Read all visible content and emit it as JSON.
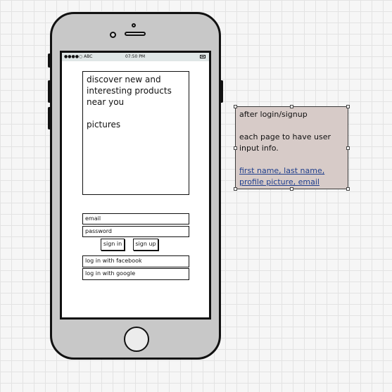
{
  "status_bar": {
    "carrier": "●●●●○ ABC",
    "time": "07:50 PM",
    "battery_icon": "battery-icon"
  },
  "hero": {
    "line1": "discover new and",
    "line2": "interesting products",
    "line3": "near you",
    "line4": "pictures"
  },
  "login": {
    "email_placeholder": "email",
    "password_placeholder": "password",
    "sign_in_label": "sign in",
    "sign_up_label": "sign up",
    "facebook_label": "log in with facebook",
    "google_label": "log in with google"
  },
  "note": {
    "line1": "after login/signup",
    "line2": "each page to have user",
    "line3": "input info.",
    "link1": "first name, last name,",
    "link2": "profile picture, email"
  },
  "colors": {
    "note_background": "#d7cbc8",
    "link": "#1f3e8c",
    "phone_body": "#c8c8c8"
  }
}
